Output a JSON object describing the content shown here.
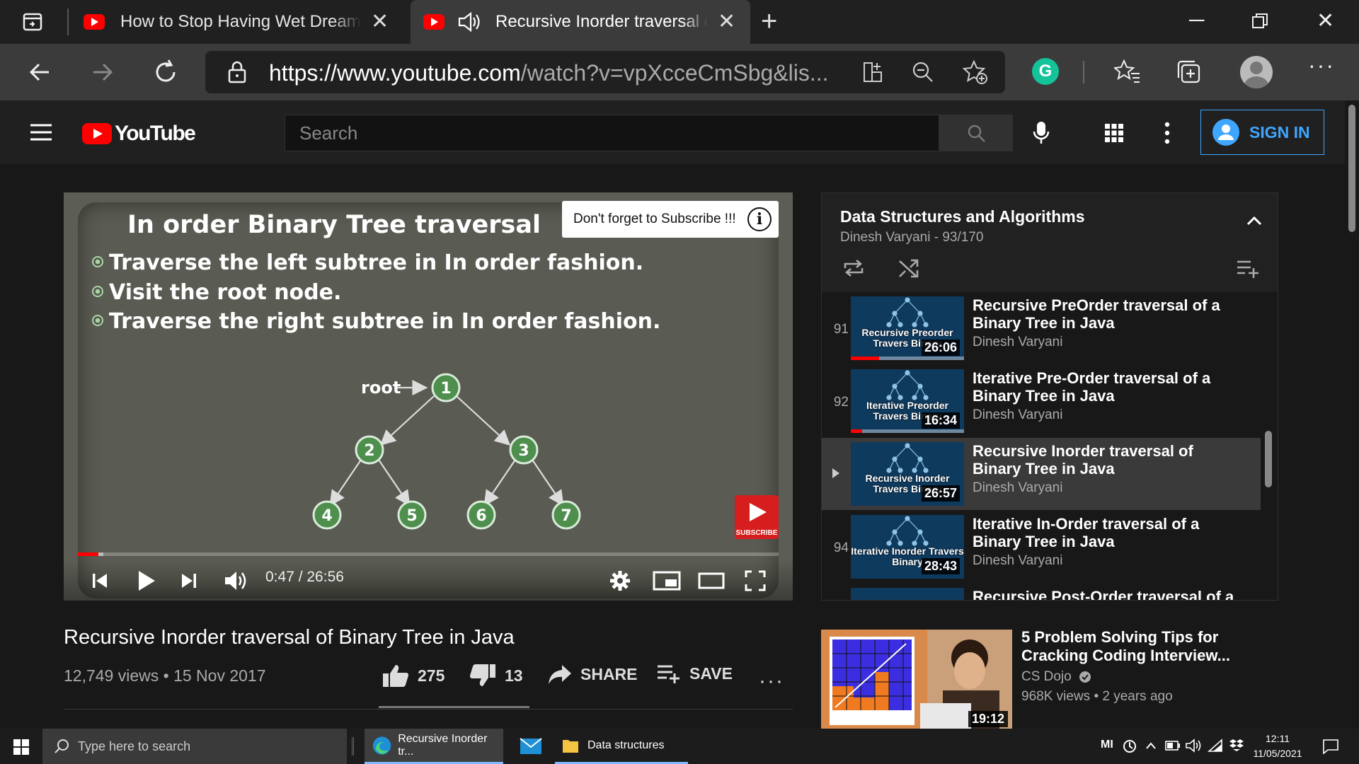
{
  "browser": {
    "tabs": [
      {
        "title": "How to Stop Having Wet Dreams",
        "active": false
      },
      {
        "title": "Recursive Inorder traversal of Binary Tree in Java",
        "active": true
      }
    ],
    "url": {
      "host": "https://www.youtube.com",
      "path": "/watch?v=vpXcceCmSbg&lis..."
    }
  },
  "youtube": {
    "logo_text": "YouTube",
    "search_placeholder": "Search",
    "sign_in_label": "SIGN IN"
  },
  "player": {
    "slide": {
      "title": "In order Binary Tree traversal",
      "bullets": [
        "Traverse the left subtree in In order fashion.",
        "Visit the root node.",
        "Traverse the right subtree in In order fashion."
      ],
      "root_label": "root",
      "nodes": [
        "1",
        "2",
        "3",
        "4",
        "5",
        "6",
        "7"
      ]
    },
    "subscribe_note": "Don't forget to Subscribe !!!",
    "subscribe_badge": "SUBSCRIBE",
    "time": "0:47 / 26:56",
    "progress_fraction": 0.029,
    "buffered_fraction": 0.036
  },
  "video": {
    "title": "Recursive Inorder traversal of Binary Tree in Java",
    "stats": "12,749 views • 15 Nov 2017",
    "likes": "275",
    "dislikes": "13",
    "share_label": "SHARE",
    "save_label": "SAVE"
  },
  "playlist": {
    "title": "Data Structures and Algorithms",
    "subtitle": "Dinesh Varyani - 93/170",
    "items": [
      {
        "index": "91",
        "title": "Recursive PreOrder traversal of a Binary Tree in Java",
        "author": "Dinesh Varyani",
        "duration": "26:06",
        "thumb_text": "Recursive Preorder Travers Binary",
        "watched": 0.25
      },
      {
        "index": "92",
        "title": "Iterative Pre-Order traversal of a Binary Tree in Java",
        "author": "Dinesh Varyani",
        "duration": "16:34",
        "thumb_text": "Iterative Preorder Travers Binary",
        "watched": 0.1
      },
      {
        "index": "93",
        "title": "Recursive Inorder traversal of Binary Tree in Java",
        "author": "Dinesh Varyani",
        "duration": "26:57",
        "thumb_text": "Recursive Inorder Travers Binary",
        "watched": 0
      },
      {
        "index": "94",
        "title": "Iterative In-Order traversal of a Binary Tree in Java",
        "author": "Dinesh Varyani",
        "duration": "28:43",
        "thumb_text": "Iterative Inorder Travers Binary",
        "watched": 0
      },
      {
        "index": "",
        "title": "Recursive Post-Order traversal of a",
        "author": "",
        "duration": "",
        "thumb_text": "",
        "watched": 0
      }
    ]
  },
  "recommendation": {
    "title": "5 Problem Solving Tips for Cracking Coding Interview...",
    "channel": "CS Dojo",
    "meta": "968K views • 2 years ago",
    "duration": "19:12"
  },
  "taskbar": {
    "search_placeholder": "Type here to search",
    "apps": [
      {
        "label": "Recursive Inorder tr..."
      },
      {
        "label": "Data structures"
      }
    ],
    "time": "12:11",
    "date": "11/05/2021"
  },
  "colors": {
    "youtube_red": "#ff0000",
    "accent_blue": "#3ea6ff",
    "node_green": "#4e8f4e"
  }
}
